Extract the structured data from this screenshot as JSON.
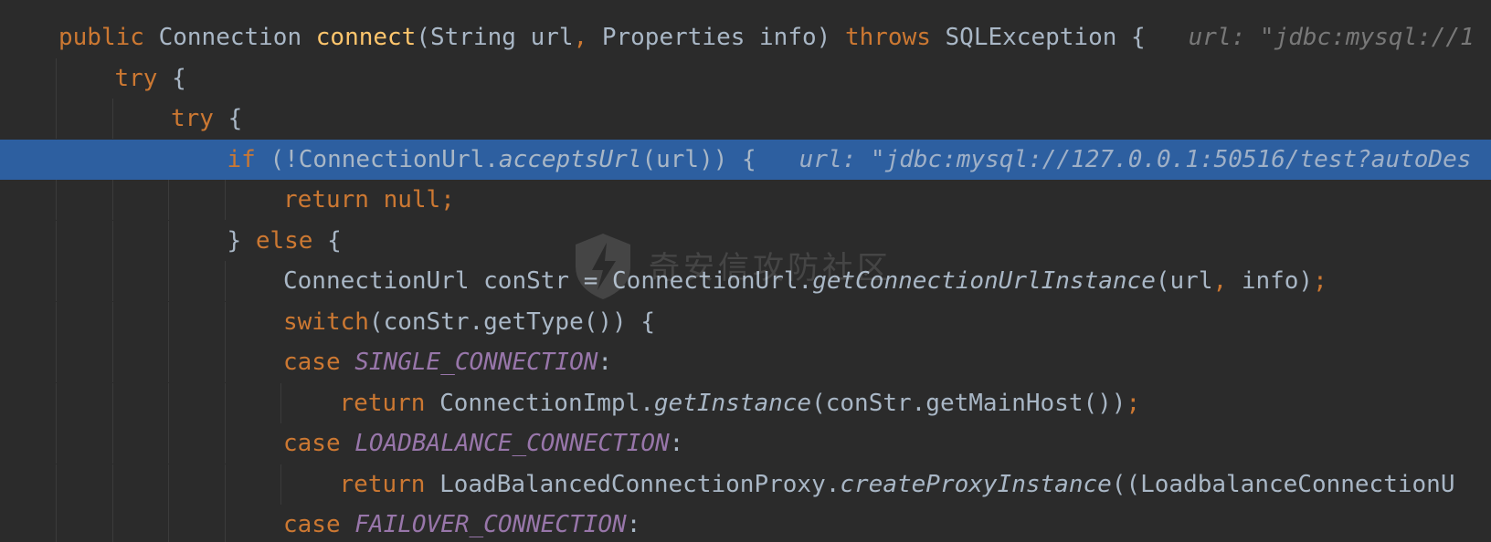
{
  "editor": {
    "highlight_color": "#2d5fa0",
    "background": "#2b2b2b",
    "lines": [
      {
        "indent": 0,
        "highlight": false,
        "tokens": [
          {
            "t": "public ",
            "c": "kw"
          },
          {
            "t": "Connection ",
            "c": "plain"
          },
          {
            "t": "connect",
            "c": "fn"
          },
          {
            "t": "(String url",
            "c": "plain"
          },
          {
            "t": ", ",
            "c": "kw"
          },
          {
            "t": "Properties info) ",
            "c": "plain"
          },
          {
            "t": "throws ",
            "c": "kw"
          },
          {
            "t": "SQLException {",
            "c": "plain"
          },
          {
            "t": "   url: \"jdbc:mysql://1",
            "c": "hint"
          }
        ]
      },
      {
        "indent": 1,
        "highlight": false,
        "tokens": [
          {
            "t": "try ",
            "c": "kw"
          },
          {
            "t": "{",
            "c": "plain"
          }
        ]
      },
      {
        "indent": 2,
        "highlight": false,
        "tokens": [
          {
            "t": "try ",
            "c": "kw"
          },
          {
            "t": "{",
            "c": "plain"
          }
        ]
      },
      {
        "indent": 3,
        "highlight": true,
        "tokens": [
          {
            "t": "if ",
            "c": "kw"
          },
          {
            "t": "(!ConnectionUrl.",
            "c": "plain"
          },
          {
            "t": "acceptsUrl",
            "c": "ital"
          },
          {
            "t": "(url)) {",
            "c": "plain"
          },
          {
            "t": "   url: \"jdbc:mysql://127.0.0.1:50516/test?autoDes",
            "c": "hint"
          }
        ]
      },
      {
        "indent": 4,
        "highlight": false,
        "tokens": [
          {
            "t": "return null;",
            "c": "kw"
          }
        ]
      },
      {
        "indent": 3,
        "highlight": false,
        "tokens": [
          {
            "t": "} ",
            "c": "plain"
          },
          {
            "t": "else ",
            "c": "kw"
          },
          {
            "t": "{",
            "c": "plain"
          }
        ]
      },
      {
        "indent": 4,
        "highlight": false,
        "tokens": [
          {
            "t": "ConnectionUrl conStr = ConnectionUrl.",
            "c": "plain"
          },
          {
            "t": "getConnectionUrlInstance",
            "c": "ital"
          },
          {
            "t": "(url",
            "c": "plain"
          },
          {
            "t": ", ",
            "c": "kw"
          },
          {
            "t": "info)",
            "c": "plain"
          },
          {
            "t": ";",
            "c": "kw"
          }
        ]
      },
      {
        "indent": 4,
        "highlight": false,
        "tokens": [
          {
            "t": "switch",
            "c": "kw"
          },
          {
            "t": "(conStr.getType()) {",
            "c": "plain"
          }
        ]
      },
      {
        "indent": 4,
        "highlight": false,
        "tokens": [
          {
            "t": "case ",
            "c": "kw"
          },
          {
            "t": "SINGLE_CONNECTION",
            "c": "const"
          },
          {
            "t": ":",
            "c": "plain"
          }
        ]
      },
      {
        "indent": 5,
        "highlight": false,
        "tokens": [
          {
            "t": "return ",
            "c": "kw"
          },
          {
            "t": "ConnectionImpl.",
            "c": "plain"
          },
          {
            "t": "getInstance",
            "c": "ital"
          },
          {
            "t": "(conStr.getMainHost())",
            "c": "plain"
          },
          {
            "t": ";",
            "c": "kw"
          }
        ]
      },
      {
        "indent": 4,
        "highlight": false,
        "tokens": [
          {
            "t": "case ",
            "c": "kw"
          },
          {
            "t": "LOADBALANCE_CONNECTION",
            "c": "const"
          },
          {
            "t": ":",
            "c": "plain"
          }
        ]
      },
      {
        "indent": 5,
        "highlight": false,
        "tokens": [
          {
            "t": "return ",
            "c": "kw"
          },
          {
            "t": "LoadBalancedConnectionProxy.",
            "c": "plain"
          },
          {
            "t": "createProxyInstance",
            "c": "ital"
          },
          {
            "t": "((LoadbalanceConnectionU",
            "c": "plain"
          }
        ]
      },
      {
        "indent": 4,
        "highlight": false,
        "tokens": [
          {
            "t": "case ",
            "c": "kw"
          },
          {
            "t": "FAILOVER_CONNECTION",
            "c": "const"
          },
          {
            "t": ":",
            "c": "plain"
          }
        ]
      }
    ]
  },
  "watermark": {
    "icon": "shield-bolt-icon",
    "text": "奇安信攻防社区"
  }
}
